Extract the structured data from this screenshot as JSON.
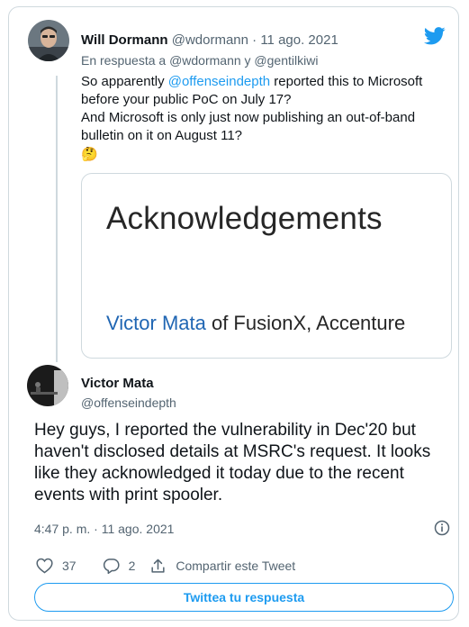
{
  "colors": {
    "accent": "#1d9bf0",
    "text": "#0f1419",
    "muted": "#536471",
    "border": "#cfd9de"
  },
  "parent_tweet": {
    "author_name": "Will Dormann",
    "author_handle": "@wdormann",
    "separator": " · ",
    "date": "11 ago. 2021",
    "reply_prefix": "En respuesta a ",
    "reply_user1": "@wdormann",
    "reply_joiner": " y ",
    "reply_user2": "@gentilkiwi",
    "line1_pre": "So apparently ",
    "line1_mention": "@offenseindepth",
    "line1_post": " reported this to Microsoft",
    "line2": "before your public PoC on July 17?",
    "line3": "And Microsoft is only just now publishing an out-of-band",
    "line4": "bulletin on it on August 11?",
    "emoji": "🤔",
    "image": {
      "title": "Acknowledgements",
      "credit_name": "Victor Mata",
      "credit_rest": " of FusionX, Accenture"
    }
  },
  "main_tweet": {
    "author_name": "Victor Mata",
    "author_handle": "@offenseindepth",
    "lines": [
      "Hey guys, I reported the vulnerability in Dec'20 but",
      "haven't disclosed details at MSRC's request. It looks",
      "like they acknowledged it today due to the recent",
      "events with print spooler."
    ],
    "time": "4:47 p. m.",
    "separator": " · ",
    "date": "11 ago. 2021"
  },
  "actions": {
    "likes": "37",
    "replies": "2",
    "share_label": "Compartir este Tweet"
  },
  "reply_button_label": "Twittea tu respuesta",
  "icons": [
    "twitter-bird-icon",
    "heart-icon",
    "reply-icon",
    "share-icon",
    "info-icon"
  ]
}
